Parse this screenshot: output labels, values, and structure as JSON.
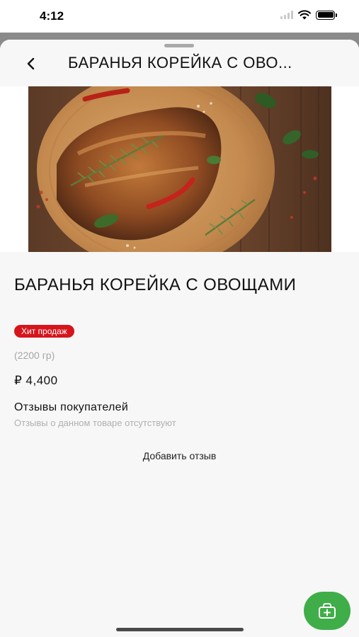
{
  "status_bar": {
    "time": "4:12"
  },
  "nav": {
    "title": "БАРАНЬЯ КОРЕЙКА С ОВО..."
  },
  "product": {
    "title": "БАРАНЬЯ КОРЕЙКА С ОВОЩАМИ",
    "badge": "Хит продаж",
    "weight": "(2200 гр)",
    "price": "₽ 4,400"
  },
  "reviews": {
    "heading": "Отзывы покупателей",
    "empty_text": "Отзывы о данном товаре отсутствуют",
    "add_label": "Добавить отзыв"
  },
  "icons": {
    "back": "chevron-left-icon",
    "cart": "cart-plus-icon"
  },
  "colors": {
    "badge": "#d7141c",
    "cart_button": "#3fae49"
  }
}
